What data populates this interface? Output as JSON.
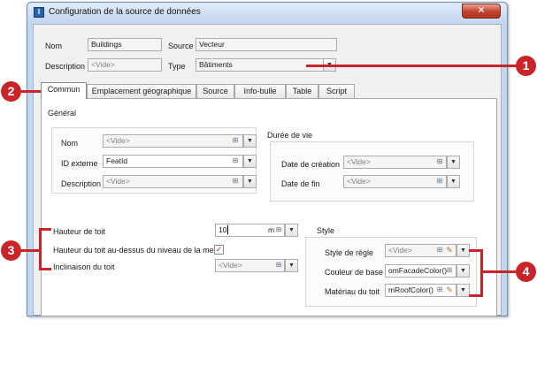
{
  "window": {
    "title": "Configuration de la source de données",
    "close_glyph": "✕",
    "app_icon": "layer-config-icon"
  },
  "header": {
    "name_label": "Nom",
    "name_value": "Buildings",
    "source_label": "Source",
    "source_value": "Vecteur",
    "description_label": "Description",
    "description_value": "<Vide>",
    "type_label": "Type",
    "type_value": "Bâtiments"
  },
  "tabs": [
    {
      "label": "Commun",
      "active": true
    },
    {
      "label": "Emplacement géographique",
      "active": false
    },
    {
      "label": "Source",
      "active": false
    },
    {
      "label": "Info-bulle",
      "active": false
    },
    {
      "label": "Table",
      "active": false
    },
    {
      "label": "Script",
      "active": false
    }
  ],
  "general": {
    "title": "Général",
    "nom_label": "Nom",
    "nom_value": "<Vide>",
    "id_label": "ID externe",
    "id_value": "FeatId",
    "desc_label": "Description",
    "desc_value": "<Vide>"
  },
  "lifetime": {
    "title": "Durée de vie",
    "created_label": "Date de création",
    "created_value": "<Vide>",
    "end_label": "Date de fin",
    "end_value": "<Vide>"
  },
  "roof": {
    "height_label": "Hauteur de toit",
    "height_value": "10",
    "height_unit": "m",
    "above_label": "Hauteur du toit au-dessus du niveau de la mer",
    "above_checked": true,
    "incline_label": "Inclinaison du toit",
    "incline_value": "<Vide>"
  },
  "style": {
    "title": "Style",
    "rule_label": "Style de règle",
    "rule_value": "<Vide>",
    "base_label": "Couleur de base",
    "base_value": "omFacadeColor()",
    "roof_label": "Matériau du toit",
    "roof_value": "mRoofColor()"
  },
  "callouts": [
    "1",
    "2",
    "3",
    "4"
  ],
  "colors": {
    "annotation": "#c8252b",
    "titlebar": "#c3d7ee",
    "close_button": "#c2412d"
  }
}
